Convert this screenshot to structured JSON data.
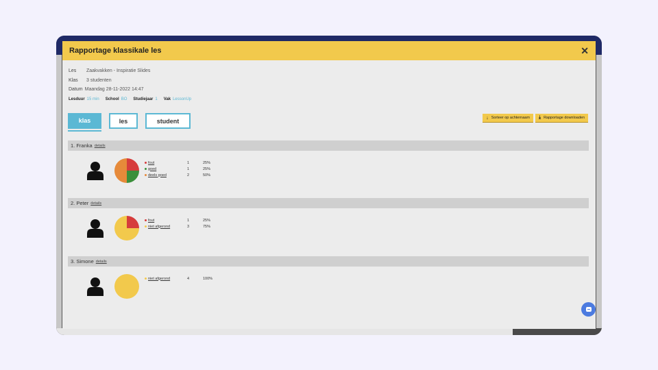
{
  "modal": {
    "title": "Rapportage klassikale les",
    "close": "✕"
  },
  "meta": {
    "les_label": "Les",
    "les_value": "Zaakvakken - Inspiratie Slides",
    "klas_label": "Klas",
    "klas_value": "3 studenten",
    "datum_label": "Datum",
    "datum_value": "Maandag 28-11-2022 14:47",
    "lesduur_label": "Lesduur",
    "lesduur_value": "15 min",
    "school_label": "School",
    "school_value": "BO",
    "studiejaar_label": "Studiejaar",
    "studiejaar_value": "1",
    "vak_label": "Vak",
    "vak_value": "LessonUp"
  },
  "tabs": [
    {
      "label": "klas",
      "active": true
    },
    {
      "label": "les",
      "active": false
    },
    {
      "label": "student",
      "active": false
    }
  ],
  "actions": {
    "sort_label": "Sorteer op achternaam",
    "download_label": "Rapportage downloaden"
  },
  "colors": {
    "fout": "#d63c3c",
    "goed": "#3b8f3b",
    "deels_goed": "#e68a3a",
    "niet_afgerond": "#f2c94c"
  },
  "students": [
    {
      "name": "1. Franka",
      "details": "details",
      "results": [
        {
          "label": "fout",
          "count": "1",
          "pct": "25%",
          "value": 1,
          "color": "#d63c3c"
        },
        {
          "label": "goed",
          "count": "1",
          "pct": "25%",
          "value": 1,
          "color": "#3b8f3b"
        },
        {
          "label": "deels goed",
          "count": "2",
          "pct": "50%",
          "value": 2,
          "color": "#e68a3a"
        }
      ]
    },
    {
      "name": "2. Peter",
      "details": "details",
      "results": [
        {
          "label": "fout",
          "count": "1",
          "pct": "25%",
          "value": 1,
          "color": "#d63c3c"
        },
        {
          "label": "niet afgerond",
          "count": "3",
          "pct": "75%",
          "value": 3,
          "color": "#f2c94c"
        }
      ]
    },
    {
      "name": "3. Simone",
      "details": "details",
      "results": [
        {
          "label": "niet afgerond",
          "count": "4",
          "pct": "100%",
          "value": 4,
          "color": "#f2c94c"
        }
      ]
    }
  ]
}
